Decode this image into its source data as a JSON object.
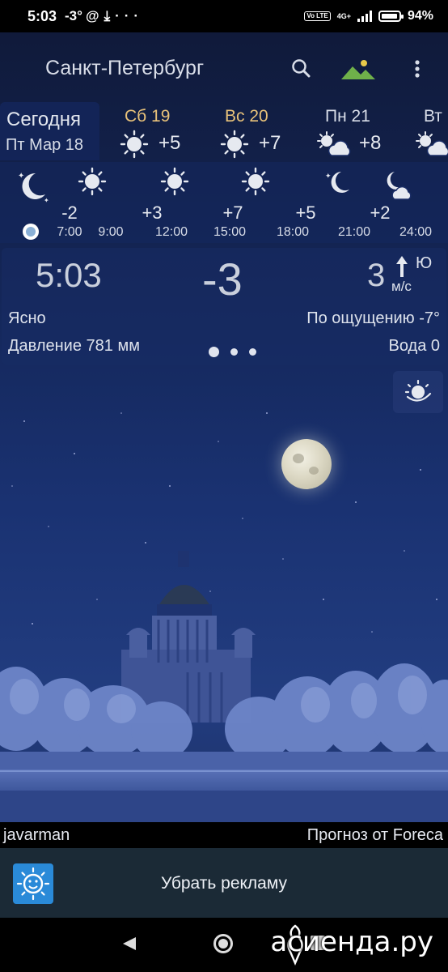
{
  "status_bar": {
    "time": "5:03",
    "temperature": "-3°",
    "icons": [
      "at-icon",
      "download-icon",
      "more-icon"
    ],
    "network": "4G+",
    "volte": "Vo LTE",
    "battery_level": 0.94,
    "battery": "94%"
  },
  "header": {
    "city": "Санкт-Петербург"
  },
  "days": {
    "today_title": "Сегодня",
    "today_date": "Пт Мар 18",
    "items": [
      {
        "name": "Сб 19",
        "temp": "+5",
        "icon": "sun-icon",
        "weekend": true
      },
      {
        "name": "Вс 20",
        "temp": "+7",
        "icon": "sun-icon",
        "weekend": true
      },
      {
        "name": "Пн 21",
        "temp": "+8",
        "icon": "sun-cloud-icon",
        "weekend": false
      },
      {
        "name": "Вт",
        "temp": "",
        "icon": "sun-cloud-icon",
        "weekend": false
      }
    ]
  },
  "hourly": {
    "items": [
      {
        "time": "7:00",
        "temp": "",
        "icon": "moon-stars-icon"
      },
      {
        "time": "9:00",
        "temp": "-2",
        "icon": "sun-icon"
      },
      {
        "time": "12:00",
        "temp": "+3",
        "icon": "sun-icon"
      },
      {
        "time": "15:00",
        "temp": "+7",
        "icon": "sun-icon"
      },
      {
        "time": "18:00",
        "temp": "+5",
        "icon": "moon-stars-icon"
      },
      {
        "time": "21:00",
        "temp": "+2",
        "icon": "moon-cloud-icon"
      },
      {
        "time": "24:00",
        "temp": "",
        "icon": ""
      }
    ]
  },
  "current": {
    "time": "5:03",
    "temperature": "-3",
    "wind_speed": "3",
    "wind_direction": "Ю",
    "wind_unit": "м/с",
    "condition": "Ясно",
    "feels_like": "По ощущению -7°",
    "pressure": "Давление 781 мм",
    "water": "Вода 0"
  },
  "footer": {
    "user": "javarman",
    "source": "Прогноз от Foreca"
  },
  "ad": {
    "label": "Убрать рекламу"
  },
  "watermark": "асиенда.ру",
  "colors": {
    "accent_weekend": "#e8c27a",
    "sky_top": "#101a3a",
    "sky_bottom": "#223d80",
    "ad_background": "#1b2a36"
  }
}
